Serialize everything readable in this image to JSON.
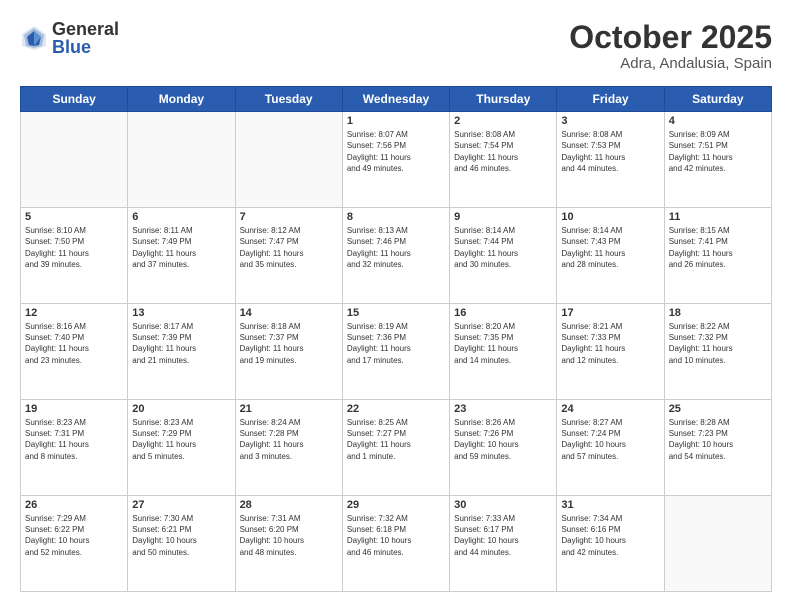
{
  "logo": {
    "general": "General",
    "blue": "Blue"
  },
  "title": {
    "month": "October 2025",
    "location": "Adra, Andalusia, Spain"
  },
  "weekdays": [
    "Sunday",
    "Monday",
    "Tuesday",
    "Wednesday",
    "Thursday",
    "Friday",
    "Saturday"
  ],
  "weeks": [
    [
      {
        "day": "",
        "info": ""
      },
      {
        "day": "",
        "info": ""
      },
      {
        "day": "",
        "info": ""
      },
      {
        "day": "1",
        "info": "Sunrise: 8:07 AM\nSunset: 7:56 PM\nDaylight: 11 hours\nand 49 minutes."
      },
      {
        "day": "2",
        "info": "Sunrise: 8:08 AM\nSunset: 7:54 PM\nDaylight: 11 hours\nand 46 minutes."
      },
      {
        "day": "3",
        "info": "Sunrise: 8:08 AM\nSunset: 7:53 PM\nDaylight: 11 hours\nand 44 minutes."
      },
      {
        "day": "4",
        "info": "Sunrise: 8:09 AM\nSunset: 7:51 PM\nDaylight: 11 hours\nand 42 minutes."
      }
    ],
    [
      {
        "day": "5",
        "info": "Sunrise: 8:10 AM\nSunset: 7:50 PM\nDaylight: 11 hours\nand 39 minutes."
      },
      {
        "day": "6",
        "info": "Sunrise: 8:11 AM\nSunset: 7:49 PM\nDaylight: 11 hours\nand 37 minutes."
      },
      {
        "day": "7",
        "info": "Sunrise: 8:12 AM\nSunset: 7:47 PM\nDaylight: 11 hours\nand 35 minutes."
      },
      {
        "day": "8",
        "info": "Sunrise: 8:13 AM\nSunset: 7:46 PM\nDaylight: 11 hours\nand 32 minutes."
      },
      {
        "day": "9",
        "info": "Sunrise: 8:14 AM\nSunset: 7:44 PM\nDaylight: 11 hours\nand 30 minutes."
      },
      {
        "day": "10",
        "info": "Sunrise: 8:14 AM\nSunset: 7:43 PM\nDaylight: 11 hours\nand 28 minutes."
      },
      {
        "day": "11",
        "info": "Sunrise: 8:15 AM\nSunset: 7:41 PM\nDaylight: 11 hours\nand 26 minutes."
      }
    ],
    [
      {
        "day": "12",
        "info": "Sunrise: 8:16 AM\nSunset: 7:40 PM\nDaylight: 11 hours\nand 23 minutes."
      },
      {
        "day": "13",
        "info": "Sunrise: 8:17 AM\nSunset: 7:39 PM\nDaylight: 11 hours\nand 21 minutes."
      },
      {
        "day": "14",
        "info": "Sunrise: 8:18 AM\nSunset: 7:37 PM\nDaylight: 11 hours\nand 19 minutes."
      },
      {
        "day": "15",
        "info": "Sunrise: 8:19 AM\nSunset: 7:36 PM\nDaylight: 11 hours\nand 17 minutes."
      },
      {
        "day": "16",
        "info": "Sunrise: 8:20 AM\nSunset: 7:35 PM\nDaylight: 11 hours\nand 14 minutes."
      },
      {
        "day": "17",
        "info": "Sunrise: 8:21 AM\nSunset: 7:33 PM\nDaylight: 11 hours\nand 12 minutes."
      },
      {
        "day": "18",
        "info": "Sunrise: 8:22 AM\nSunset: 7:32 PM\nDaylight: 11 hours\nand 10 minutes."
      }
    ],
    [
      {
        "day": "19",
        "info": "Sunrise: 8:23 AM\nSunset: 7:31 PM\nDaylight: 11 hours\nand 8 minutes."
      },
      {
        "day": "20",
        "info": "Sunrise: 8:23 AM\nSunset: 7:29 PM\nDaylight: 11 hours\nand 5 minutes."
      },
      {
        "day": "21",
        "info": "Sunrise: 8:24 AM\nSunset: 7:28 PM\nDaylight: 11 hours\nand 3 minutes."
      },
      {
        "day": "22",
        "info": "Sunrise: 8:25 AM\nSunset: 7:27 PM\nDaylight: 11 hours\nand 1 minute."
      },
      {
        "day": "23",
        "info": "Sunrise: 8:26 AM\nSunset: 7:26 PM\nDaylight: 10 hours\nand 59 minutes."
      },
      {
        "day": "24",
        "info": "Sunrise: 8:27 AM\nSunset: 7:24 PM\nDaylight: 10 hours\nand 57 minutes."
      },
      {
        "day": "25",
        "info": "Sunrise: 8:28 AM\nSunset: 7:23 PM\nDaylight: 10 hours\nand 54 minutes."
      }
    ],
    [
      {
        "day": "26",
        "info": "Sunrise: 7:29 AM\nSunset: 6:22 PM\nDaylight: 10 hours\nand 52 minutes."
      },
      {
        "day": "27",
        "info": "Sunrise: 7:30 AM\nSunset: 6:21 PM\nDaylight: 10 hours\nand 50 minutes."
      },
      {
        "day": "28",
        "info": "Sunrise: 7:31 AM\nSunset: 6:20 PM\nDaylight: 10 hours\nand 48 minutes."
      },
      {
        "day": "29",
        "info": "Sunrise: 7:32 AM\nSunset: 6:18 PM\nDaylight: 10 hours\nand 46 minutes."
      },
      {
        "day": "30",
        "info": "Sunrise: 7:33 AM\nSunset: 6:17 PM\nDaylight: 10 hours\nand 44 minutes."
      },
      {
        "day": "31",
        "info": "Sunrise: 7:34 AM\nSunset: 6:16 PM\nDaylight: 10 hours\nand 42 minutes."
      },
      {
        "day": "",
        "info": ""
      }
    ]
  ]
}
